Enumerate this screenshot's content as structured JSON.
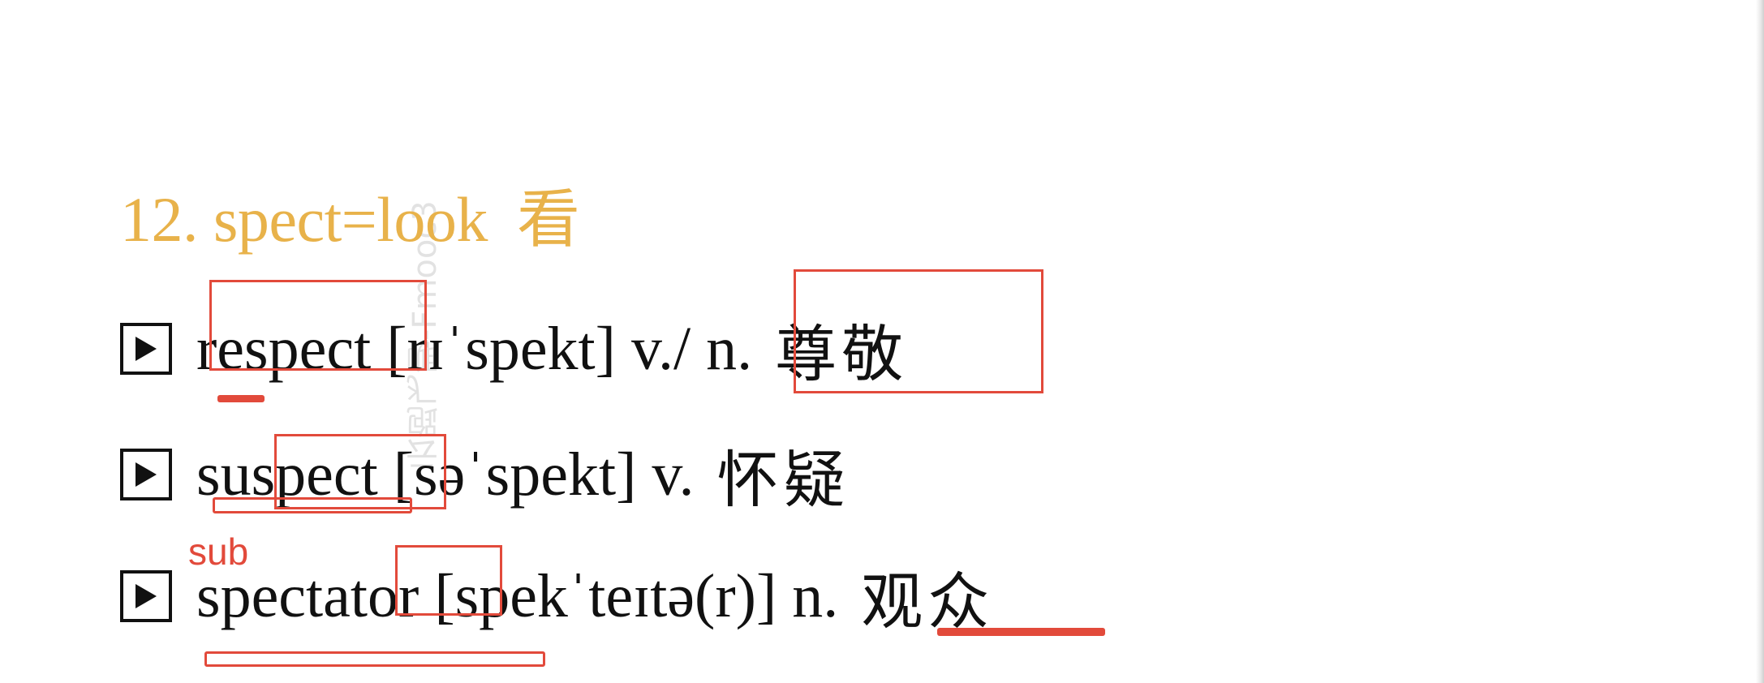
{
  "slide": {
    "title": {
      "text": "12. spect=look",
      "chinese": "看",
      "color": "#e8b24a"
    },
    "rows": [
      {
        "word": "respect",
        "phonetic": "[rɪˈspekt]",
        "pos": "v./ n.",
        "meaning": "尊敬"
      },
      {
        "word": "suspect",
        "phonetic": "[səˈspekt]",
        "pos": "v.",
        "meaning": "怀疑"
      },
      {
        "word": "spectator",
        "phonetic": "[spekˈteɪtə(r)]",
        "pos": "n.",
        "meaning": "观众"
      }
    ],
    "annotation_color": "#e24a3b",
    "handwritten_note": "sub",
    "play_icon": "play-icon",
    "watermark": [
      "云跑飞聊-Fmooc3",
      "17"
    ]
  }
}
